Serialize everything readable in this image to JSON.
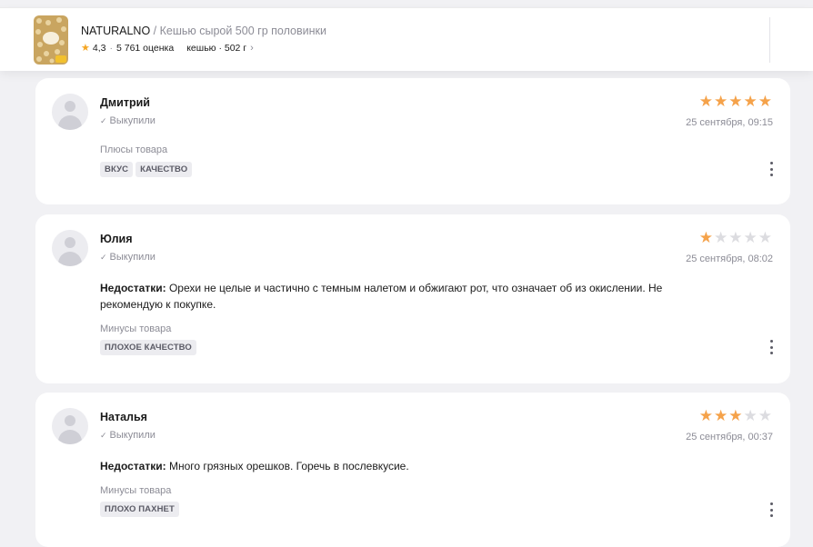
{
  "header": {
    "brand": "NATURALNO",
    "separator": " / ",
    "product": "Кешью сырой 500 гр половинки",
    "rating": "4,3",
    "dot": "·",
    "ratings_count": "5 761 оценка",
    "variant": "кешью · 502 г",
    "chevron": "›"
  },
  "reviews": [
    {
      "name": "Дмитрий",
      "bought": "Выкупили",
      "rating": 5,
      "date": "25 сентября, 09:15",
      "section_label": "Плюсы товара",
      "tags": [
        "ВКУС",
        "КАЧЕСТВО"
      ]
    },
    {
      "name": "Юлия",
      "bought": "Выкупили",
      "rating": 1,
      "date": "25 сентября, 08:02",
      "text_label": "Недостатки:",
      "text": "Орехи не целые и частично с темным налетом и обжигают рот, что означает об из окислении. Не рекомендую к покупке.",
      "section_label": "Минусы товара",
      "tags": [
        "ПЛОХОЕ КАЧЕСТВО"
      ]
    },
    {
      "name": "Наталья",
      "bought": "Выкупили",
      "rating": 3,
      "date": "25 сентября, 00:37",
      "text_label": "Недостатки:",
      "text": "Много грязных орешков. Горечь в послевкусие.",
      "section_label": "Минусы товара",
      "tags": [
        "ПЛОХО ПАХНЕТ"
      ]
    }
  ],
  "icons": {
    "star": "star-icon",
    "check": "check-icon",
    "more": "more-vertical-icon",
    "chevron": "chevron-right-icon"
  },
  "colors": {
    "star_on": "#f5a24a",
    "star_off": "#dcdce0",
    "muted": "#8c8c96",
    "tag_bg": "#ececf0"
  }
}
